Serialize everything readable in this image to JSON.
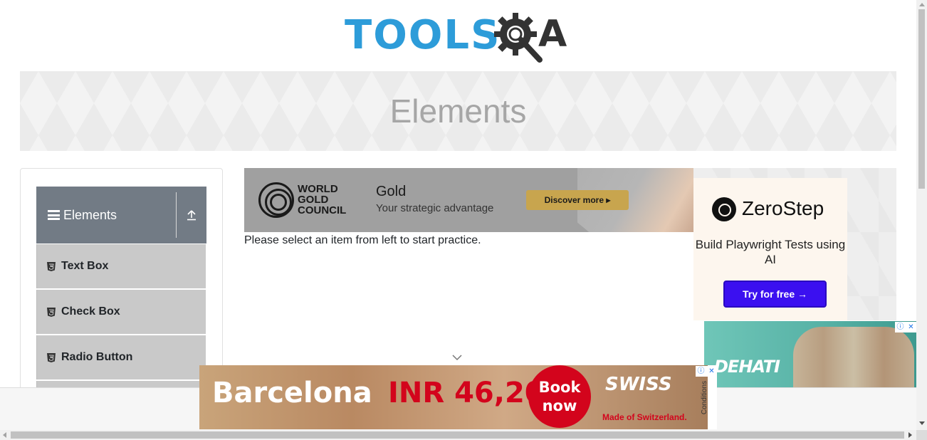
{
  "header": {
    "logo_text": "TOOLS",
    "logo_suffix": "A"
  },
  "banner": {
    "title": "Elements"
  },
  "sidebar": {
    "group_title": "Elements",
    "items": [
      {
        "label": "Text Box"
      },
      {
        "label": "Check Box"
      },
      {
        "label": "Radio Button"
      }
    ]
  },
  "main": {
    "instruction": "Please select an item from left to start practice."
  },
  "ads": {
    "top": {
      "brand": "WORLD GOLD COUNCIL",
      "headline": "Gold",
      "tagline": "Your strategic advantage",
      "cta": "Discover more ▸"
    },
    "zerostep": {
      "brand": "ZeroStep",
      "subtitle": "Build Playwright Tests using AI",
      "cta": "Try for free →"
    },
    "side_bottom": {
      "text": "DEHATI"
    },
    "bottom": {
      "city": "Barcelona",
      "price": "INR 46,20",
      "book": "Book now",
      "airline": "SWISS",
      "made": "Made of Switzerland.",
      "conditions": "Conditions"
    }
  },
  "colors": {
    "logo_blue": "#2d9cd9",
    "group_header": "#727b85",
    "menu_item": "#c9c9c9",
    "zerostep_button": "#3b10f0",
    "swiss_red": "#d3041c"
  }
}
